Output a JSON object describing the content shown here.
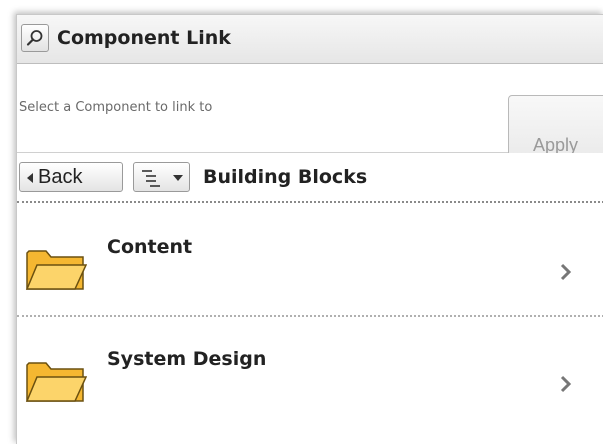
{
  "titlebar": {
    "title": "Component Link",
    "icon": "search-icon"
  },
  "select": {
    "placeholder": "Select a Component to link to",
    "value": "",
    "apply_label": "Apply"
  },
  "navigation": {
    "back_label": "Back",
    "view_icon": "list-view-icon",
    "breadcrumb": "Building Blocks"
  },
  "items": [
    {
      "label": "Content",
      "icon": "folder-icon",
      "action_icon": "chevron-right-icon"
    },
    {
      "label": "System Design",
      "icon": "folder-icon",
      "action_icon": "chevron-right-icon"
    }
  ],
  "colors": {
    "folder_fill": "#f8c447",
    "folder_stroke": "#6b5010",
    "text": "#222222",
    "disabled_text": "#9a9a9a"
  }
}
